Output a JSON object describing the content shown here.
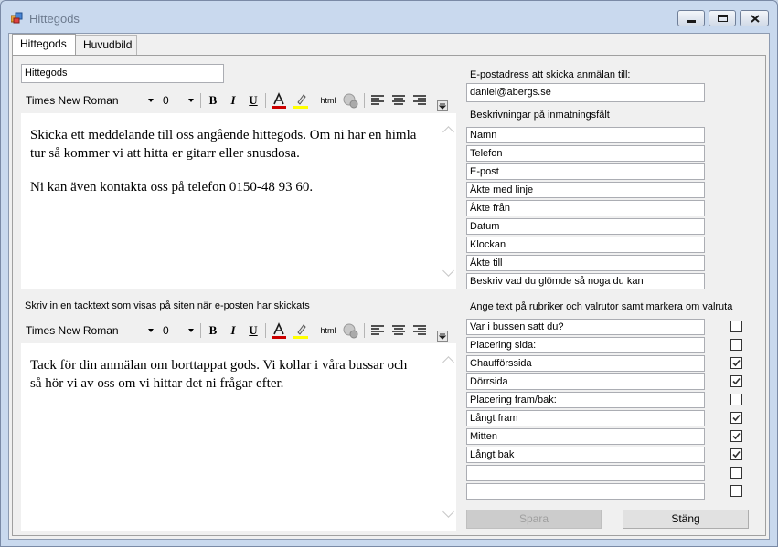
{
  "window": {
    "title": "Hittegods"
  },
  "tabs": [
    {
      "label": "Hittegods"
    },
    {
      "label": "Huvudbild"
    }
  ],
  "subject": {
    "value": "Hittegods"
  },
  "editor1": {
    "font_name": "Times New Roman",
    "font_size": "0",
    "html_label": "html",
    "paragraphs": [
      "Skicka ett meddelande till oss angående hittegods. Om ni har en himla tur så kommer vi att hitta er gitarr eller snusdosa.",
      "Ni kan även kontakta oss på telefon 0150-48 93 60."
    ]
  },
  "thanks_label": "Skriv in en tacktext som visas på siten när e-posten har skickats",
  "editor2": {
    "font_name": "Times New Roman",
    "font_size": "0",
    "html_label": "html",
    "paragraphs": [
      "Tack för din anmälan om borttappat gods. Vi kollar i våra bussar och så hör vi av oss om vi hittar det ni frågar efter."
    ]
  },
  "email": {
    "label": "E-postadress att skicka anmälan till:",
    "value": "daniel@abergs.se"
  },
  "fields": {
    "label": "Beskrivningar på inmatningsfält",
    "values": [
      "Namn",
      "Telefon",
      "E-post",
      "Åkte med linje",
      "Åkte från",
      "Datum",
      "Klockan",
      "Åkte till",
      "Beskriv vad du glömde så noga du kan"
    ]
  },
  "checks": {
    "label": "Ange text på rubriker och valrutor samt markera om valruta",
    "rows": [
      {
        "text": "Var i bussen satt du?",
        "checked": false
      },
      {
        "text": "Placering sida:",
        "checked": false
      },
      {
        "text": "Chaufförssida",
        "checked": true
      },
      {
        "text": "Dörrsida",
        "checked": true
      },
      {
        "text": "Placering fram/bak:",
        "checked": false
      },
      {
        "text": "Långt fram",
        "checked": true
      },
      {
        "text": "Mitten",
        "checked": true
      },
      {
        "text": "Långt bak",
        "checked": true
      },
      {
        "text": "",
        "checked": false
      },
      {
        "text": "",
        "checked": false
      }
    ]
  },
  "buttons": {
    "save": "Spara",
    "close": "Stäng"
  },
  "colors": {
    "font_color": "#cc0000",
    "highlight": "#ffff00"
  }
}
